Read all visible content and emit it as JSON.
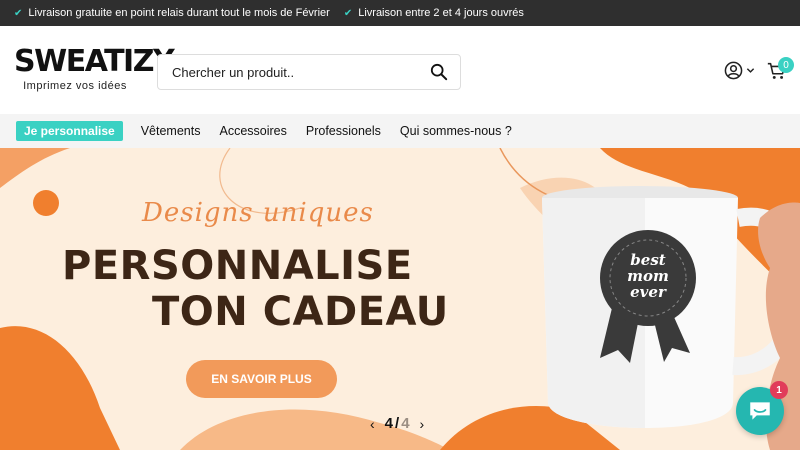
{
  "announcement": {
    "messages": [
      "Livraison gratuite en point relais durant tout le mois de Février",
      "Livraison entre 2 et 4 jours ouvrés"
    ],
    "icon": "check-icon"
  },
  "header": {
    "logo_text": "SWEATIZY",
    "logo_tagline": "Imprimez vos idées",
    "search_placeholder": "Chercher un produit..",
    "cart_count": "0"
  },
  "nav": {
    "highlight_label": "Je personnalise",
    "items": [
      "Vêtements",
      "Accessoires",
      "Professionels",
      "Qui sommes-nous ?"
    ]
  },
  "hero": {
    "script_text": "Designs uniques",
    "title_line1": "PERSONNALISE",
    "title_line2": "TON CADEAU",
    "cta_label": "EN SAVOIR PLUS",
    "mug_text": [
      "best",
      "mom",
      "ever"
    ],
    "slide_current": "4",
    "slide_separator": "/",
    "slide_total": "4"
  },
  "chat": {
    "unread_count": "1"
  },
  "colors": {
    "accent": "#3ad1c3",
    "hero_bg": "#fdeedd",
    "hero_orange": "#f29a5a",
    "title_brown": "#3d2616",
    "chat": "#25b7b0",
    "badge_red": "#e13c5a"
  }
}
